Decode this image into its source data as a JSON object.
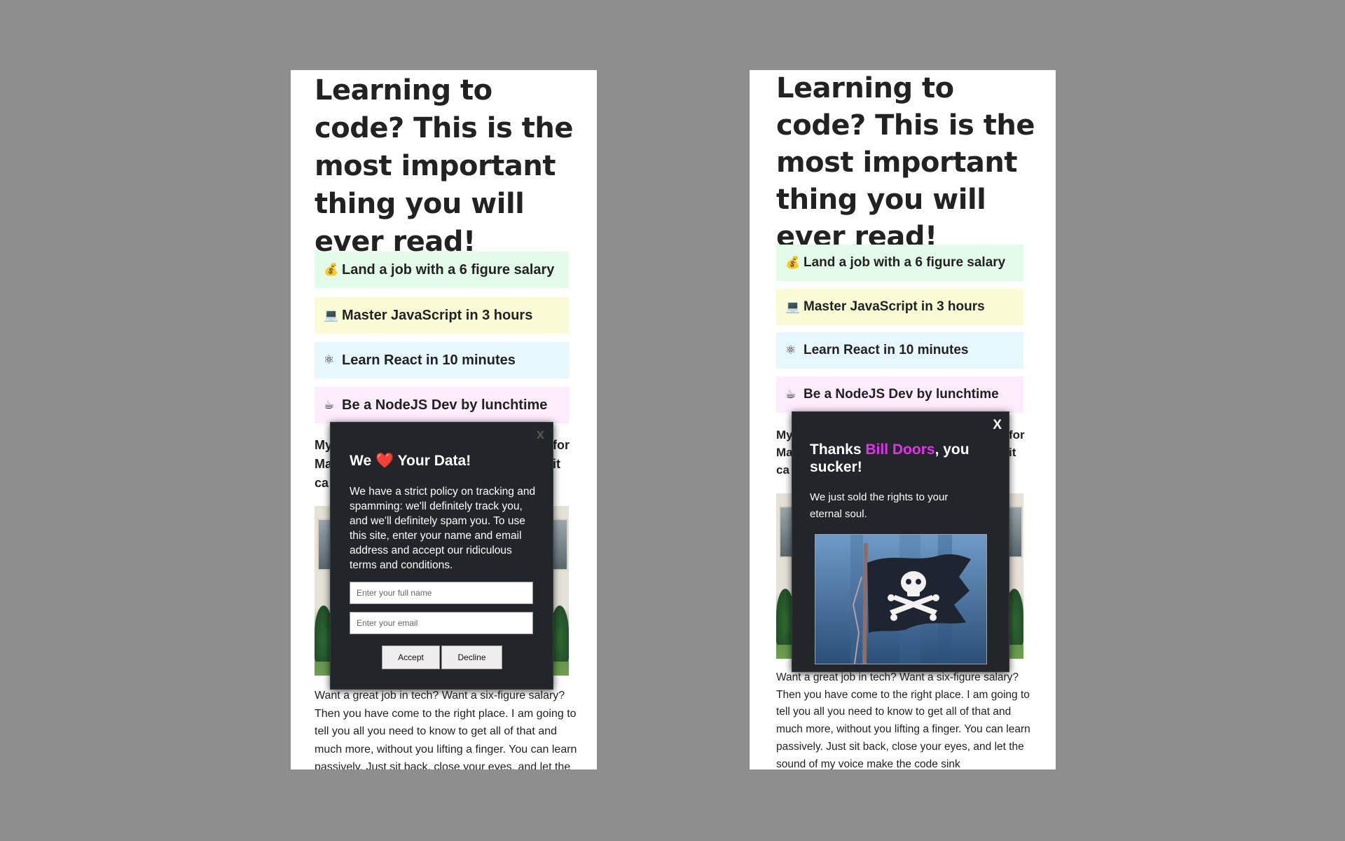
{
  "article": {
    "title": "Learning to code? This is the most important thing you will ever read!",
    "benefits": [
      {
        "emoji": "💰",
        "label": "Land a job with a 6 figure salary"
      },
      {
        "emoji": "💻",
        "label": "Master JavaScript in 3 hours"
      },
      {
        "emoji": "⚛",
        "label": "Learn React in 10 minutes"
      },
      {
        "emoji": "☕",
        "label": "Be a NodeJS Dev by lunchtime"
      }
    ],
    "intro_fragments": {
      "left_line1": "My",
      "left_line2": "Ma",
      "left_line3": "ca",
      "right_line1": "for",
      "right_line2": "it"
    },
    "body_text": "Want a great job in tech? Want a six-figure salary? Then you have come to the right place. I am going to tell you all you need to know to get all of that and much more, without you lifting a finger. You can learn passively. Just sit back, close your eyes, and let the sound of my voice make the code sink"
  },
  "consent_modal": {
    "close_label": "x",
    "title_prefix": "We",
    "title_heart": "❤️",
    "title_suffix": "Your Data!",
    "description": "We have a strict policy on tracking and spamming: we'll definitely track you, and we'll definitely spam you. To use this site, enter your name and email address and accept our ridiculous terms and conditions.",
    "name_placeholder": "Enter your full name",
    "email_placeholder": "Enter your email",
    "accept_label": "Accept",
    "decline_label": "Decline"
  },
  "thanks_modal": {
    "close_label": "X",
    "title_prefix": "Thanks",
    "user_name": "Bill Doors",
    "title_suffix": ", you sucker!",
    "message": "We just sold the rights to your eternal soul.",
    "image_icon": "pirate-flag-icon"
  },
  "colors": {
    "background": "#8e8e8e",
    "modal_background": "#22252a",
    "highlight": "#e82ff0",
    "benefit_green": "#e3fbe9",
    "benefit_yellow": "#fbfbd6",
    "benefit_blue": "#e6f7fd",
    "benefit_pink": "#fcecfc"
  }
}
